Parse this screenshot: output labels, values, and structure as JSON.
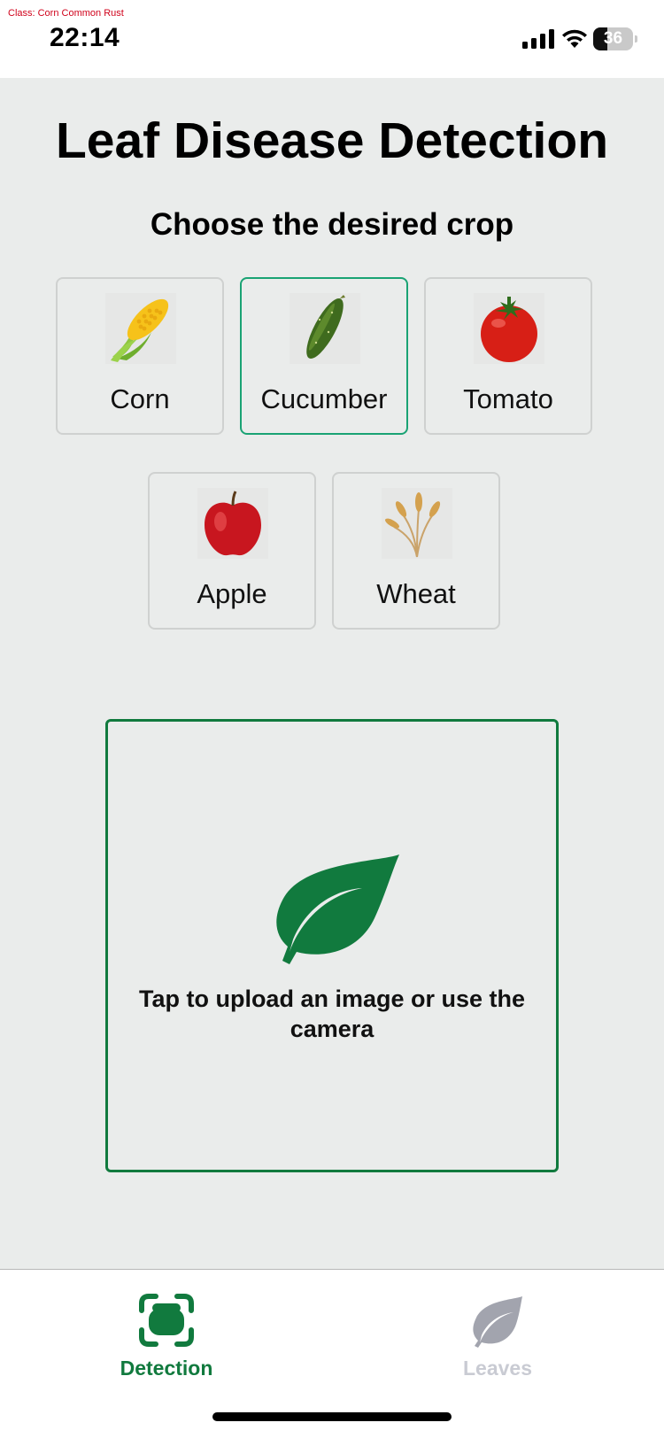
{
  "status_bar": {
    "debug_text": "Class: Corn Common Rust",
    "time": "22:14",
    "battery_level": "36",
    "battery_fraction": 0.36
  },
  "header": {
    "title": "Leaf Disease Detection",
    "subtitle": "Choose the desired crop"
  },
  "crops": [
    {
      "label": "Corn",
      "icon": "corn-icon",
      "selected": false
    },
    {
      "label": "Cucumber",
      "icon": "cucumber-icon",
      "selected": true
    },
    {
      "label": "Tomato",
      "icon": "tomato-icon",
      "selected": false
    },
    {
      "label": "Apple",
      "icon": "apple-icon",
      "selected": false
    },
    {
      "label": "Wheat",
      "icon": "wheat-icon",
      "selected": false
    }
  ],
  "upload": {
    "prompt": "Tap to upload an image or use the camera",
    "icon": "leaf-icon"
  },
  "tabbar": {
    "tabs": [
      {
        "label": "Detection",
        "icon": "detection-icon",
        "active": true
      },
      {
        "label": "Leaves",
        "icon": "leaves-icon",
        "active": false
      }
    ]
  },
  "colors": {
    "accent": "#117a3e",
    "selected_border": "#1aa374",
    "background": "#eaeceb",
    "inactive_tab": "#c9cbd3"
  }
}
